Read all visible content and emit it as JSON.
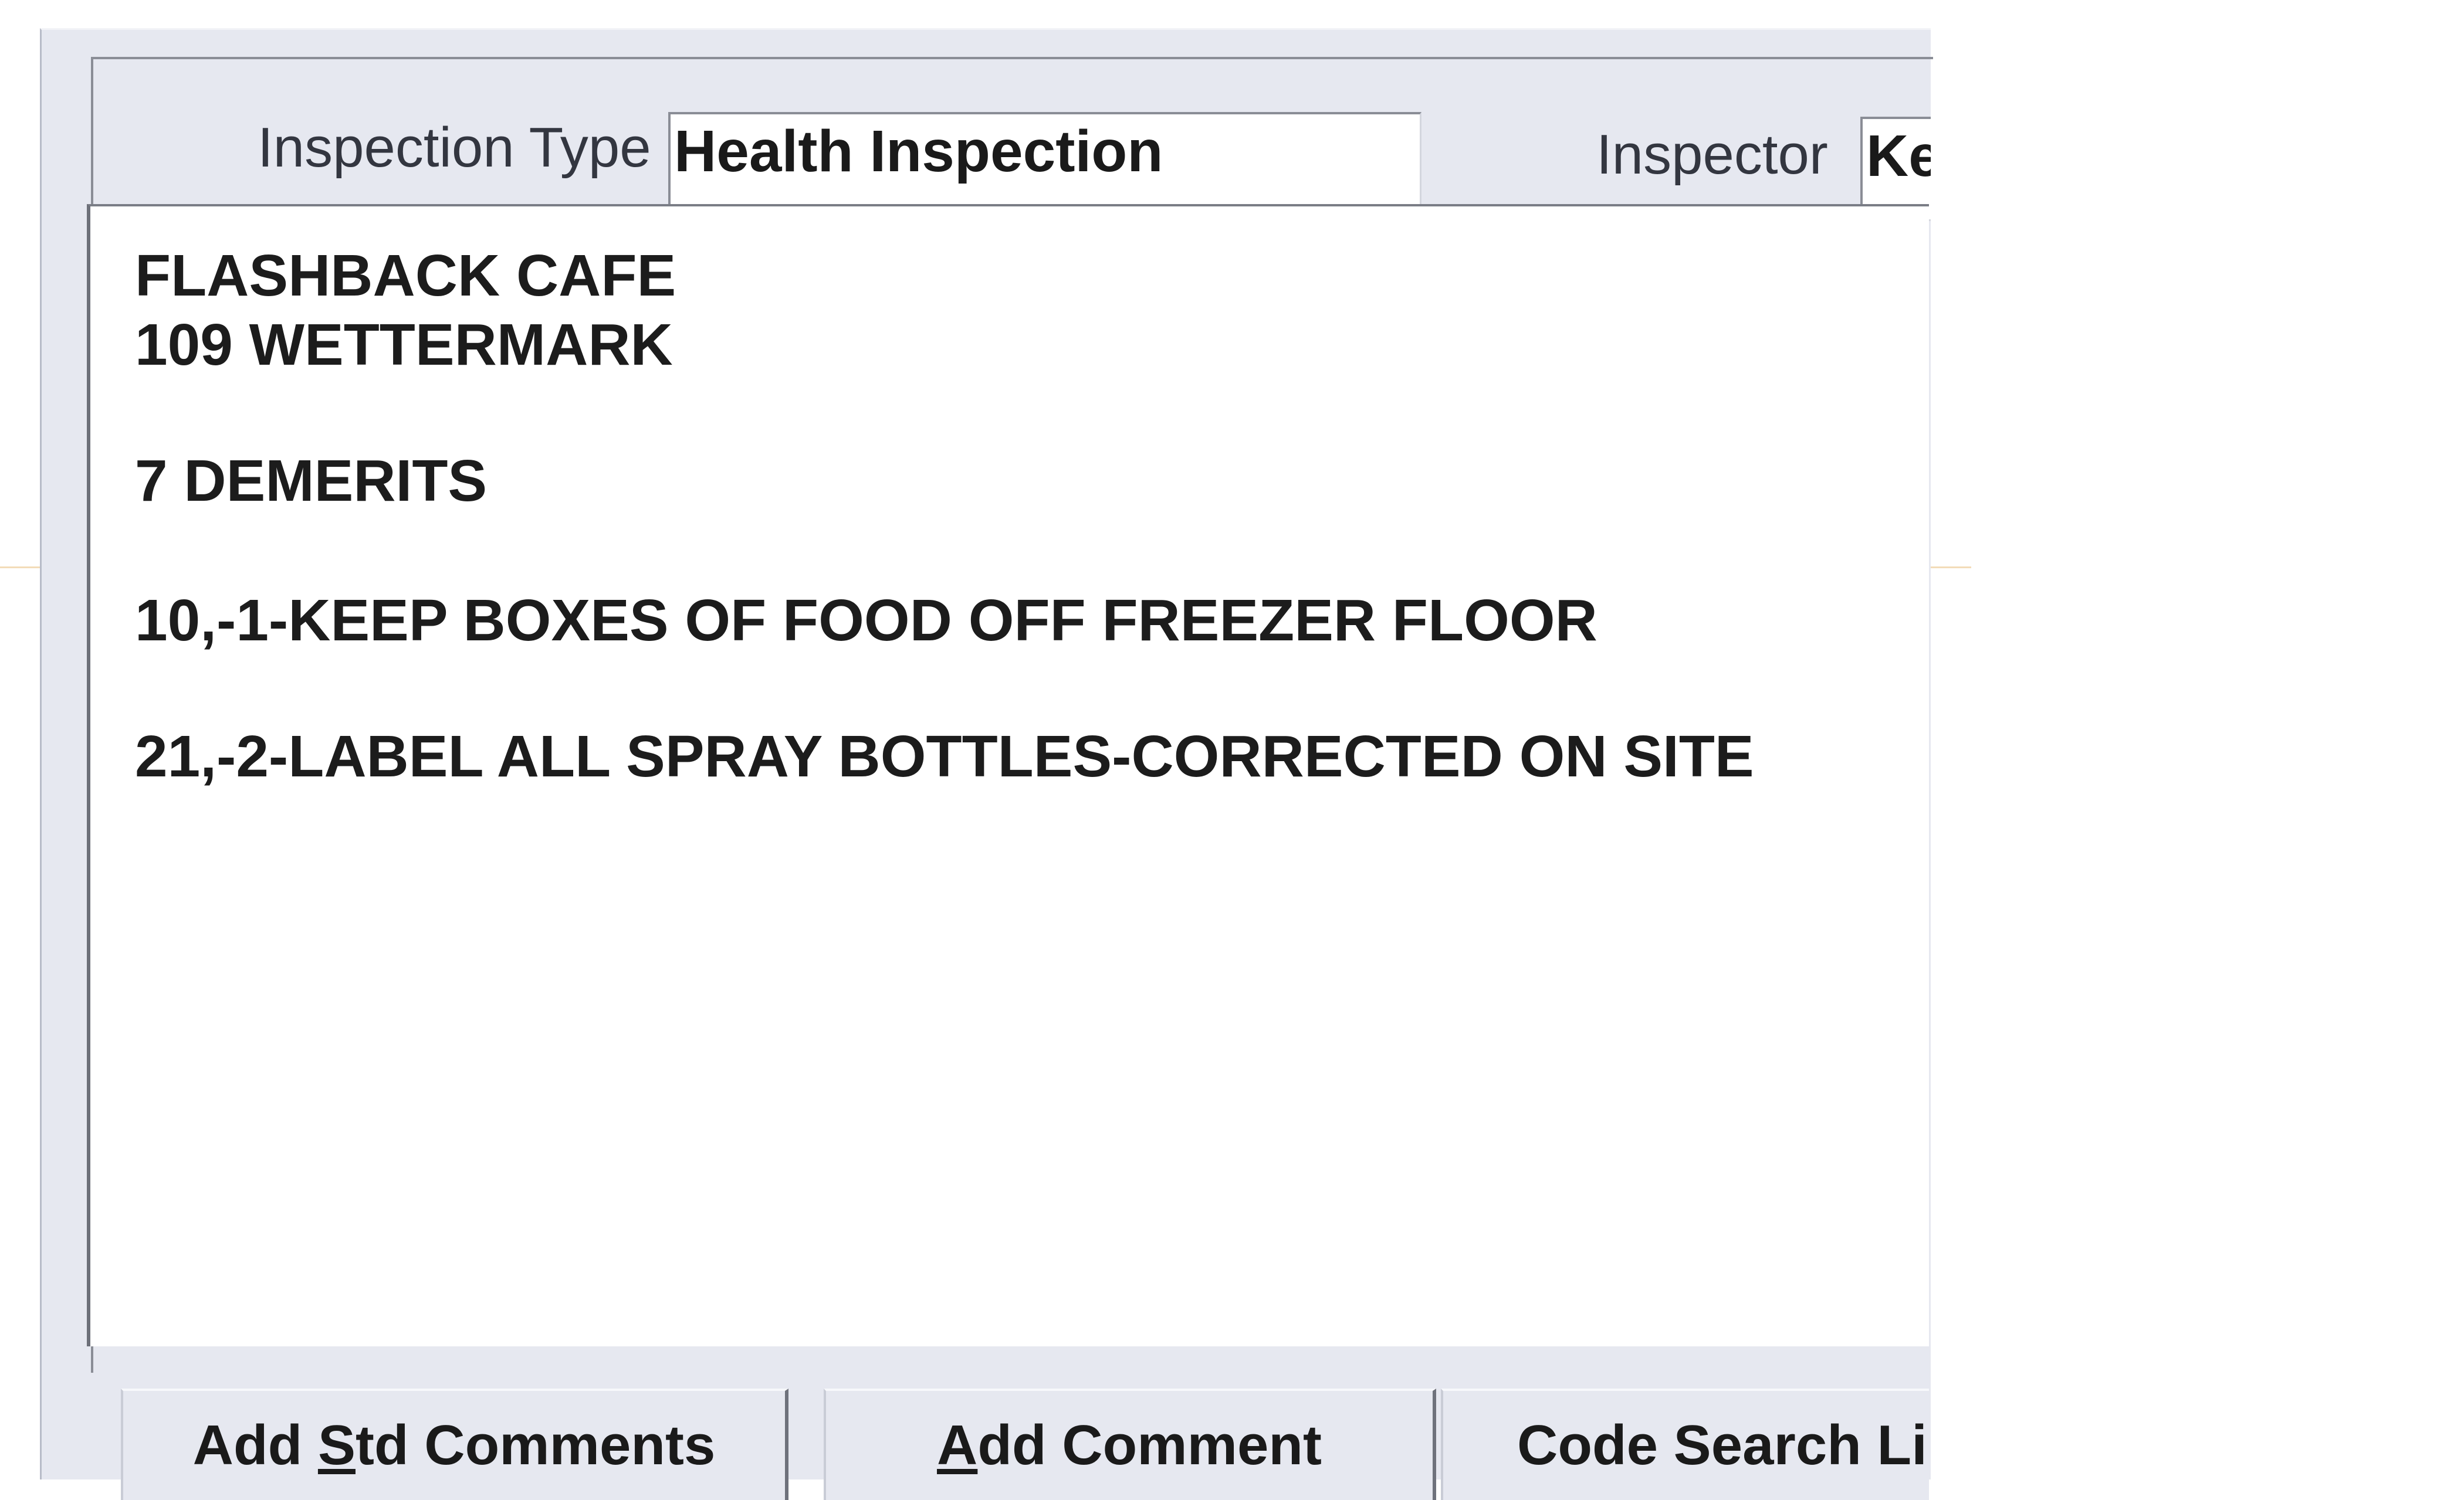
{
  "header": {
    "inspection_type_label": "Inspection Type",
    "inspection_type_value": "Health Inspection",
    "inspector_label": "Inspector",
    "inspector_value": "Ke"
  },
  "comments": {
    "lines": [
      "FLASHBACK CAFE",
      "109 WETTERMARK",
      "7 DEMERITS",
      "10,-1-KEEP BOXES OF FOOD OFF FREEZER FLOOR",
      "21,-2-LABEL ALL SPRAY BOTTLES-CORRECTED ON SITE"
    ]
  },
  "buttons": {
    "add_std_comments": {
      "mnemonic_before": "Add ",
      "mnemonic": "S",
      "mnemonic_after": "td Comments"
    },
    "add_comment": {
      "mnemonic_before": "",
      "mnemonic": "A",
      "mnemonic_after": "dd Comment"
    },
    "code_search": {
      "label": "Code Search Li"
    }
  }
}
